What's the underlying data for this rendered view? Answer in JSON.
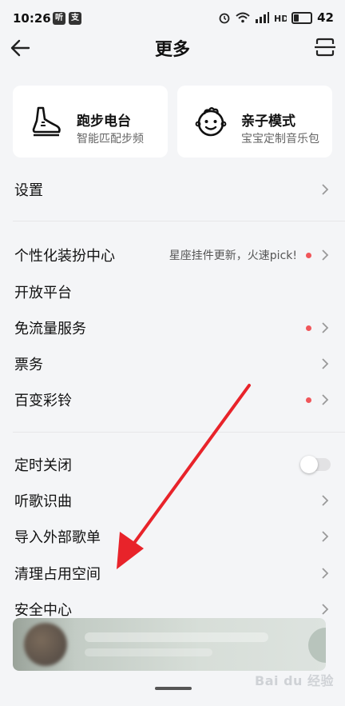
{
  "status_bar": {
    "time": "10:26",
    "badge1": "听",
    "badge2": "支",
    "battery": "42"
  },
  "nav": {
    "title": "更多"
  },
  "cards": [
    {
      "title": "跑步电台",
      "subtitle": "智能匹配步频",
      "icon": "running-shoe-icon"
    },
    {
      "title": "亲子模式",
      "subtitle": "宝宝定制音乐包",
      "icon": "baby-face-icon"
    }
  ],
  "menu": {
    "settings": "设置",
    "theme_center": "个性化装扮中心",
    "theme_center_hint": "星座挂件更新，火速pick!",
    "open_platform": "开放平台",
    "free_data": "免流量服务",
    "tickets": "票务",
    "ringtones": "百变彩铃",
    "sleep_timer": "定时关闭",
    "song_recognition": "听歌识曲",
    "import_playlist": "导入外部歌单",
    "clean_storage": "清理占用空间",
    "security_center": "安全中心"
  },
  "watermark": "Bai du 经验",
  "colors": {
    "accent_red": "#f0565a",
    "background": "#f4f5f7",
    "arrow": "#e8232a"
  }
}
